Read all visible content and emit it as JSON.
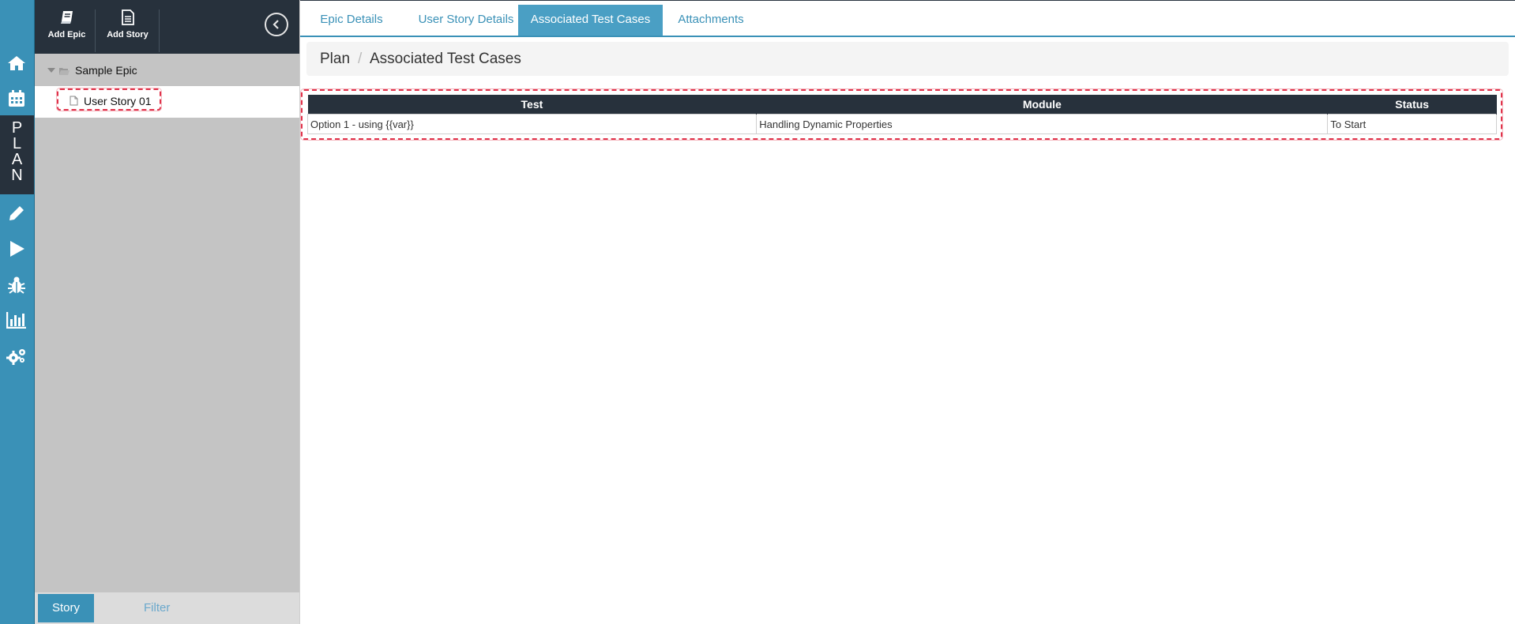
{
  "rail": {
    "plan_letters": [
      "P",
      "L",
      "A",
      "N"
    ],
    "icons": [
      "home-icon",
      "calendar-icon",
      "pencil-icon",
      "play-icon",
      "bug-icon",
      "bar-chart-icon",
      "settings-icon"
    ]
  },
  "toolbar": {
    "add_epic_label": "Add Epic",
    "add_story_label": "Add Story"
  },
  "tree": {
    "epic_label": "Sample Epic",
    "story_label": "User Story 01"
  },
  "bottom_tabs": {
    "story_label": "Story",
    "filter_label": "Filter"
  },
  "tabs": {
    "epic_details": "Epic Details",
    "user_story_details": "User Story Details",
    "associated_test_cases": "Associated Test Cases",
    "attachments": "Attachments",
    "active": "associated_test_cases"
  },
  "breadcrumb": {
    "root": "Plan",
    "separator": "/",
    "current": "Associated Test Cases"
  },
  "table": {
    "headers": [
      "Test",
      "Module",
      "Status"
    ],
    "rows": [
      [
        "Option 1 - using {{var}}",
        "Handling Dynamic Properties",
        "To Start"
      ]
    ]
  },
  "colors": {
    "accent": "#3a91b7",
    "dark": "#27313c",
    "highlight": "#e0334b"
  }
}
